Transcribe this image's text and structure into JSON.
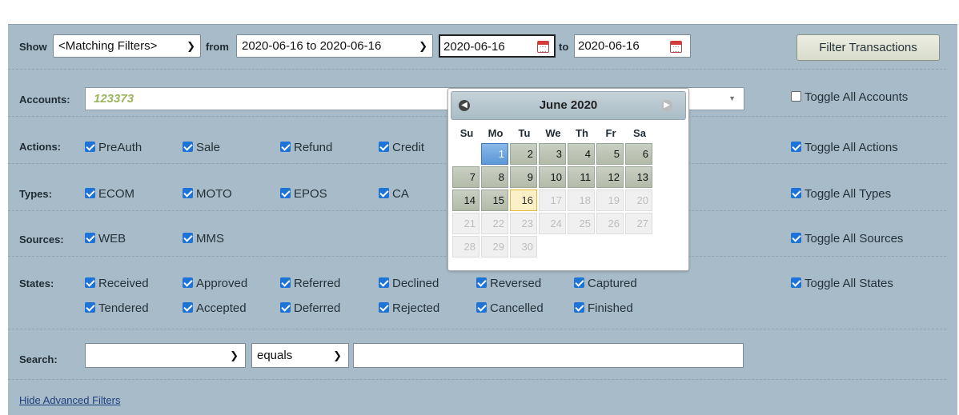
{
  "toolbar": {
    "show_label": "Show",
    "show_value": "<Matching Filters>",
    "from_label": "from",
    "range_value": "2020-06-16 to 2020-06-16",
    "date_from": "2020-06-16",
    "to_label": "to",
    "date_to": "2020-06-16",
    "filter_button": "Filter Transactions"
  },
  "accounts": {
    "label": "Accounts:",
    "value": "123373",
    "toggle": "Toggle All Accounts"
  },
  "actions": {
    "label": "Actions:",
    "items": [
      "PreAuth",
      "Sale",
      "Refund",
      "Credit"
    ],
    "toggle": "Toggle All Actions"
  },
  "types": {
    "label": "Types:",
    "items": [
      "ECOM",
      "MOTO",
      "EPOS",
      "CA"
    ],
    "toggle": "Toggle All Types"
  },
  "sources": {
    "label": "Sources:",
    "items": [
      "WEB",
      "MMS"
    ],
    "toggle": "Toggle All Sources"
  },
  "states": {
    "label": "States:",
    "row1": [
      "Received",
      "Approved",
      "Referred",
      "Declined",
      "Reversed",
      "Captured"
    ],
    "row2": [
      "Tendered",
      "Accepted",
      "Deferred",
      "Rejected",
      "Cancelled",
      "Finished"
    ],
    "toggle": "Toggle All States"
  },
  "search": {
    "label": "Search:",
    "field_value": "",
    "operator": "equals",
    "text_value": ""
  },
  "hide_link": "Hide Advanced Filters",
  "datepicker": {
    "month_title": "June 2020",
    "weekdays": [
      "Su",
      "Mo",
      "Tu",
      "We",
      "Th",
      "Fr",
      "Sa"
    ],
    "weeks": [
      [
        "",
        "1",
        "2",
        "3",
        "4",
        "5",
        "6"
      ],
      [
        "7",
        "8",
        "9",
        "10",
        "11",
        "12",
        "13"
      ],
      [
        "14",
        "15",
        "16",
        "17",
        "18",
        "19",
        "20"
      ],
      [
        "21",
        "22",
        "23",
        "24",
        "25",
        "26",
        "27"
      ],
      [
        "28",
        "29",
        "30",
        "",
        "",
        "",
        ""
      ]
    ],
    "highlight_day": "1",
    "today": "16",
    "max_enabled_day": 16
  }
}
